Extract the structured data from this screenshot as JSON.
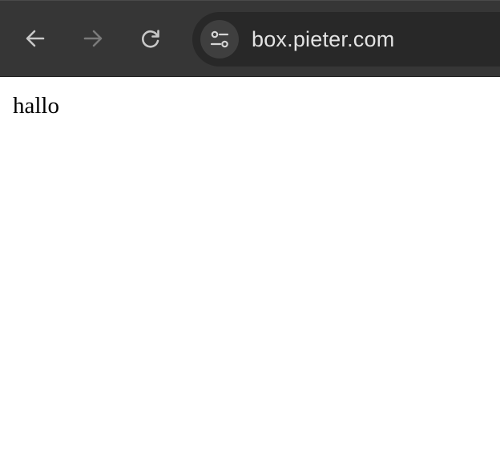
{
  "toolbar": {
    "back_icon": "arrow-left-icon",
    "forward_icon": "arrow-right-icon",
    "reload_icon": "reload-icon",
    "site_info_icon": "tune-icon",
    "url": "box.pieter.com"
  },
  "page": {
    "body_text": "hallo"
  },
  "colors": {
    "toolbar_bg": "#363636",
    "omnibox_bg": "#282828",
    "icon_active": "#c8c8c8",
    "icon_disabled": "#7a7a7a",
    "url_text": "#e3e3e3",
    "page_bg": "#ffffff"
  }
}
